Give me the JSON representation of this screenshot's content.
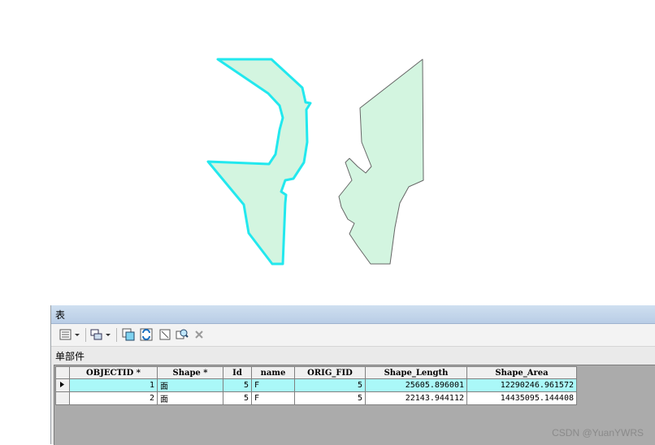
{
  "window_title": "表",
  "layer_name": "单部件",
  "colors": {
    "polygon_fill": "#d3f5e0",
    "selected_outline": "#22e8ee",
    "outline": "#6a6a6a",
    "selected_row": "#aaf8f8"
  },
  "toolbar": {
    "icons": [
      "table-options-icon",
      "related-tables-icon",
      "select-by-attributes-icon",
      "switch-selection-icon",
      "clear-selection-icon",
      "zoom-to-selected-icon",
      "delete-selected-icon"
    ]
  },
  "table": {
    "columns": [
      "OBJECTID *",
      "Shape *",
      "Id",
      "name",
      "ORIG_FID",
      "Shape_Length",
      "Shape_Area"
    ],
    "rows": [
      {
        "selected": true,
        "cells": [
          "1",
          "面",
          "5",
          "F",
          "5",
          "25605.896001",
          "12290246.961572"
        ]
      },
      {
        "selected": false,
        "cells": [
          "2",
          "面",
          "5",
          "F",
          "5",
          "22143.944112",
          "14435095.144408"
        ]
      }
    ]
  },
  "watermark": "CSDN @YuanYWRS"
}
